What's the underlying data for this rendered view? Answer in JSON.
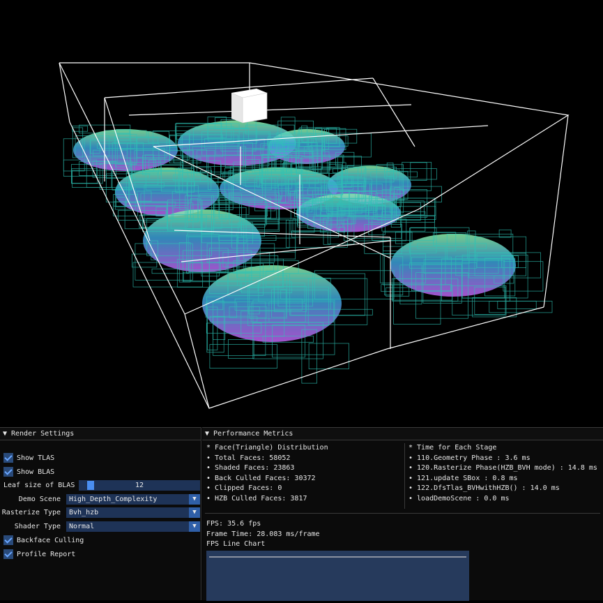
{
  "render_settings": {
    "header": "Render Settings",
    "show_tlas": {
      "label": "Show TLAS",
      "checked": true
    },
    "show_blas": {
      "label": "Show BLAS",
      "checked": true
    },
    "leaf_size": {
      "label": "Leaf size of BLAS",
      "value": "12"
    },
    "demo_scene": {
      "label": "Demo Scene",
      "value": "High_Depth_Complexity"
    },
    "rasterize_type": {
      "label": "Rasterize Type",
      "value": "Bvh_hzb"
    },
    "shader_type": {
      "label": "Shader Type",
      "value": "Normal"
    },
    "backface_culling": {
      "label": "Backface Culling",
      "checked": true
    },
    "profile_report": {
      "label": "Profile Report",
      "checked": true
    }
  },
  "performance": {
    "header": "Performance Metrics",
    "faces": {
      "title": "* Face(Triangle) Distribution",
      "items": [
        "• Total Faces: 58052",
        "• Shaded Faces: 23863",
        "• Back Culled Faces: 30372",
        "• Clipped Faces: 0",
        "• HZB Culled Faces: 3817"
      ]
    },
    "stages": {
      "title": "* Time for Each Stage",
      "items": [
        "• 110.Geometry Phase : 3.6 ms",
        "• 120.Rasterize Phase(HZB_BVH mode) : 14.8 ms",
        "• 121.update SBox : 0.8 ms",
        "• 122.DfsTlas_BVHwithHZB() : 14.0 ms",
        "• loadDemoScene : 0.0 ms"
      ]
    },
    "fps": "FPS: 35.6 fps",
    "frame_time": "Frame Time: 28.083 ms/frame",
    "chart_title": "FPS Line Chart"
  },
  "colors": {
    "panel_bg": "#0b0b0b",
    "widget_bg": "#1e3357",
    "accent": "#4a8ef0",
    "tlas_box": "#ffffff",
    "blas_box": "#2ec4b6"
  },
  "icons": {
    "collapse": "triangle-down-icon",
    "dropdown": "triangle-down-icon",
    "check": "check-icon"
  }
}
